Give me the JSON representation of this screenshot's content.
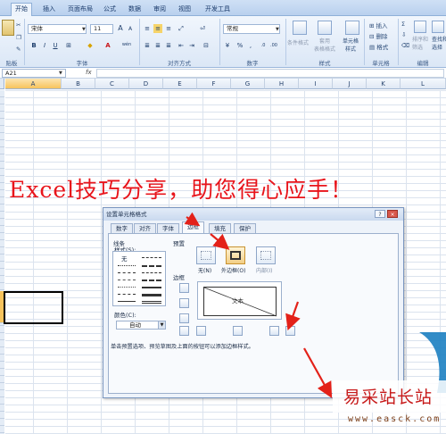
{
  "ribbon_tabs": [
    "开始",
    "插入",
    "页面布局",
    "公式",
    "数据",
    "审阅",
    "视图",
    "开发工具"
  ],
  "font_group": {
    "font_name": "宋体",
    "font_size": "11",
    "bold": "B",
    "italic": "I",
    "underline": "U",
    "grow_font": "A",
    "shrink_font": "A",
    "font_color_glyph": "A",
    "phonetic": "wén"
  },
  "number_group": {
    "format": "常规",
    "percent": "%",
    "comma": ","
  },
  "style_group": {
    "conditional_format": "条件格式",
    "table_format": "套用\n表格格式",
    "cell_style": "单元格\n样式"
  },
  "cells_group": {
    "insert": "插入",
    "delete": "删除",
    "format": "格式"
  },
  "edit_group": {
    "sort_filter": "排序和\n筛选",
    "find_select": "查找和\n选择"
  },
  "group_labels": {
    "clipboard": "贴板",
    "font": "字体",
    "alignment": "对齐方式",
    "number": "数字",
    "styles": "样式",
    "cells": "单元格",
    "editing": "编辑"
  },
  "formula_bar": {
    "name_box": "A21",
    "fx": "fx"
  },
  "columns": [
    "A",
    "B",
    "C",
    "D",
    "E",
    "F",
    "G",
    "H",
    "I",
    "J",
    "K",
    "L"
  ],
  "headline": "Excel技巧分享，助您得心应手！",
  "dialog": {
    "title": "设置单元格格式",
    "help": "?",
    "close": "×",
    "tabs": [
      "数字",
      "对齐",
      "字体",
      "边框",
      "填充",
      "保护"
    ],
    "active_tab": "边框",
    "line_label": "线条",
    "style_label": "样式(S):",
    "none_label": "无",
    "color_label": "颜色(C):",
    "color_value": "自动",
    "preset_label": "预置",
    "presets": [
      "无(N)",
      "外边框(O)",
      "内部(I)"
    ],
    "border_label": "边框",
    "preview_text": "文本",
    "hint": "单击预置选项、预览草图及上面的按钮可以添加边框样式。"
  },
  "watermark": {
    "title": "易采站长站",
    "url": "www.easck.com"
  },
  "colors": {
    "headline": "#e8141b",
    "arrow": "#e32119",
    "selection_border": "#000000"
  }
}
